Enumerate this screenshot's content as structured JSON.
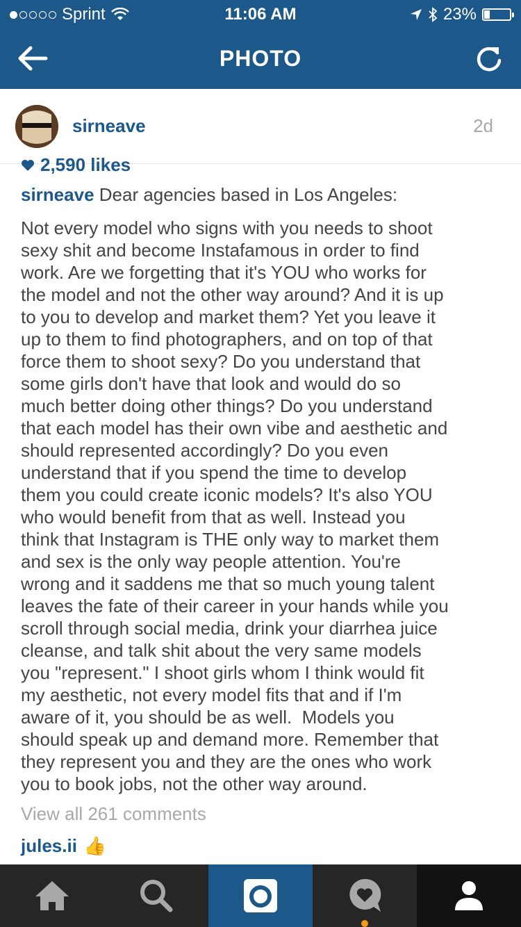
{
  "status": {
    "carrier": "Sprint",
    "time": "11:06 AM",
    "battery": "23%",
    "battery_level": 0.23
  },
  "nav": {
    "title": "PHOTO"
  },
  "post": {
    "username": "sirneave",
    "time_ago": "2d",
    "likes": "2,590 likes",
    "caption_user": "sirneave",
    "caption_first": "Dear agencies based in Los Angeles:",
    "caption_body": "Not every model who signs with you needs to shoot\nsexy shit and become Instafamous in order to find\nwork. Are we forgetting that it's YOU who works for\nthe model and not the other way around? And it is up\nto you to develop and market them? Yet you leave it\nup to them to find photographers, and on top of that\nforce them to shoot sexy? Do you understand that\nsome girls don't have that look and would do so\nmuch better doing other things? Do you understand\nthat each model has their own vibe and aesthetic and\nshould represented accordingly? Do you even\nunderstand that if you spend the time to develop\nthem you could create iconic models? It's also YOU\nwho would benefit from that as well. Instead you\nthink that Instagram is THE only way to market them\nand sex is the only way people attention. You're\nwrong and it saddens me that so much young talent\nleaves the fate of their career in your hands while you\nscroll through social media, drink your diarrhea juice\ncleanse, and talk shit about the very same models\nyou \"represent.\" I shoot girls whom I think would fit\nmy aesthetic, not every model fits that and if I'm\naware of it, you should be as well.  Models you\nshould speak up and demand more. Remember that\nthey represent you and they are the ones who work\nyou to book jobs, not the other way around.",
    "view_all": "View all 261 comments",
    "comment_user": "jules.ii",
    "comment_emoji": "👍"
  },
  "tabs": [
    {
      "name": "home",
      "icon": "home-icon"
    },
    {
      "name": "explore",
      "icon": "search-icon"
    },
    {
      "name": "camera",
      "icon": "camera-icon"
    },
    {
      "name": "activity",
      "icon": "activity-icon"
    },
    {
      "name": "profile",
      "icon": "profile-icon"
    }
  ],
  "colors": {
    "brand": "#1c5889",
    "tabbar": "#262626",
    "notification": "#f39c12"
  }
}
